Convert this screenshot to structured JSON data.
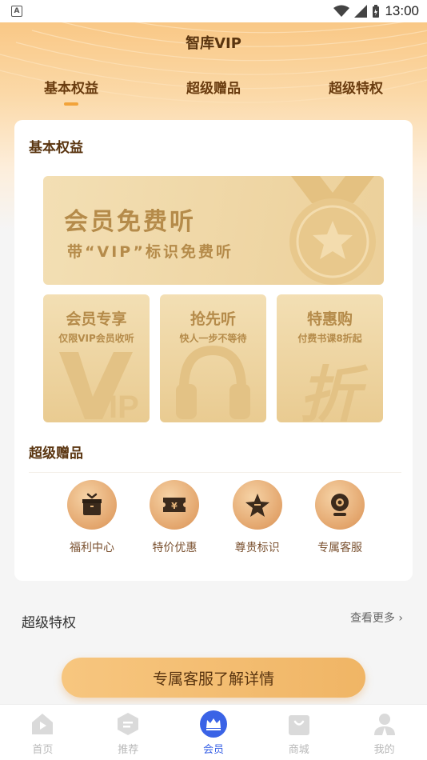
{
  "status_bar": {
    "time": "13:00"
  },
  "header": {
    "title": "智库VIP"
  },
  "tabs": [
    {
      "label": "基本权益",
      "active": true
    },
    {
      "label": "超级赠品",
      "active": false
    },
    {
      "label": "超级特权",
      "active": false
    }
  ],
  "basic_section": {
    "title": "基本权益",
    "banner": {
      "title": "会员免费听",
      "subtitle": "带“VIP”标识免费听"
    },
    "tiles": [
      {
        "title": "会员专享",
        "subtitle": "仅限VIP会员收听",
        "icon": "vip-icon"
      },
      {
        "title": "抢先听",
        "subtitle": "快人一步不等待",
        "icon": "headphones-icon"
      },
      {
        "title": "特惠购",
        "subtitle": "付费书课8折起",
        "icon": "discount-icon"
      }
    ]
  },
  "gifts_section": {
    "title": "超级赠品",
    "items": [
      {
        "label": "福利中心",
        "icon": "gift-box-icon"
      },
      {
        "label": "特价优惠",
        "icon": "coupon-icon"
      },
      {
        "label": "尊贵标识",
        "icon": "star-badge-icon"
      },
      {
        "label": "专属客服",
        "icon": "webcam-icon"
      }
    ]
  },
  "privilege_row": {
    "label": "超级特权",
    "more": "查看更多"
  },
  "cta": {
    "label": "专属客服了解详情"
  },
  "bottom_nav": [
    {
      "label": "首页",
      "icon": "home-icon",
      "active": false
    },
    {
      "label": "推荐",
      "icon": "recommend-icon",
      "active": false
    },
    {
      "label": "会员",
      "icon": "crown-icon",
      "active": true
    },
    {
      "label": "商城",
      "icon": "shopping-bag-icon",
      "active": false
    },
    {
      "label": "我的",
      "icon": "profile-icon",
      "active": false
    }
  ],
  "colors": {
    "accent": "#f2a33a",
    "gold_text": "#b58b4a",
    "nav_active": "#3a63e6"
  }
}
